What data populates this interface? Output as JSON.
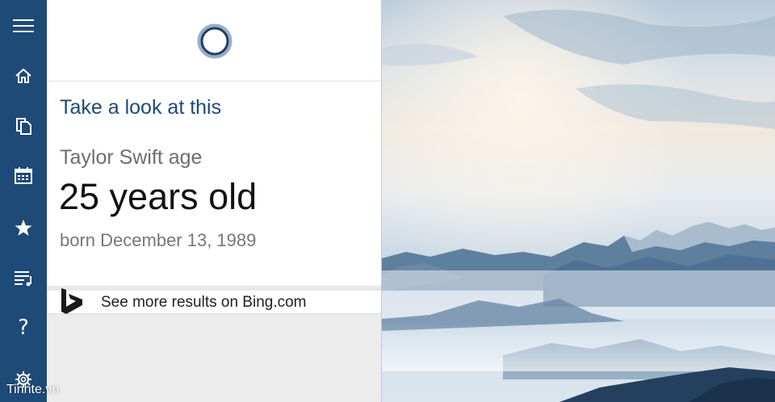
{
  "nav": {
    "items": [
      {
        "icon": "hamburger-icon"
      },
      {
        "icon": "home-icon"
      },
      {
        "icon": "notebook-icon"
      },
      {
        "icon": "calendar-icon"
      },
      {
        "icon": "star-icon"
      },
      {
        "icon": "music-list-icon"
      },
      {
        "icon": "help-icon"
      },
      {
        "icon": "gear-icon"
      }
    ],
    "help_glyph": "?"
  },
  "card": {
    "heading": "Take a look at this",
    "query": "Taylor Swift age",
    "answer": "25 years old",
    "subtext": "born December 13, 1989"
  },
  "bing": {
    "label": "See more results on Bing.com",
    "icon": "bing-logo-icon"
  },
  "watermark": "Tinhte.vn",
  "colors": {
    "rail": "#1e4a78",
    "heading": "#1e4a78",
    "ring": "#1e4a78"
  }
}
